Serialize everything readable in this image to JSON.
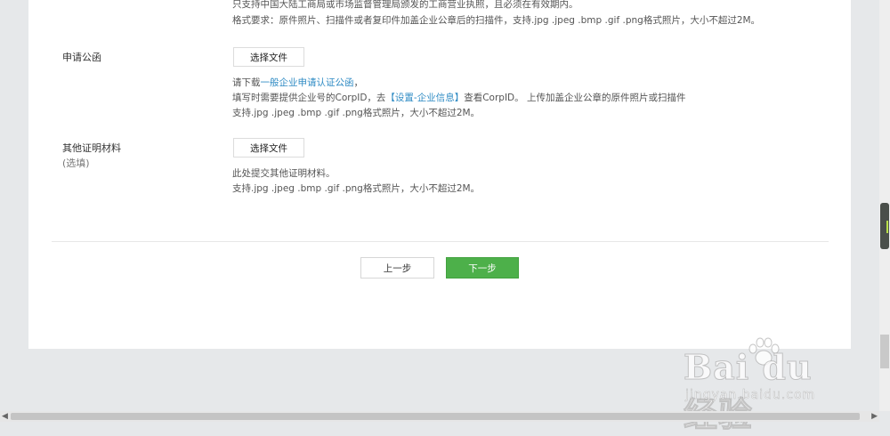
{
  "license_section": {
    "note_line1": "只支持中国大陆工商局或市场监督管理局颁发的工商营业执照，且必须在有效期内。",
    "note_line2": "格式要求：原件照片、扫描件或者复印件加盖企业公章后的扫描件，支持.jpg .jpeg .bmp .gif .png格式照片，大小不超过2M。"
  },
  "letter_section": {
    "label": "申请公函",
    "button": "选择文件",
    "line1_prefix": "请下载",
    "line1_link": "一般企业申请认证公函",
    "line1_suffix": "，",
    "line2_prefix": "填写时需要提供企业号的CorpID，去",
    "line2_link": "【设置-企业信息】",
    "line2_suffix": "查看CorpID。 上传加盖企业公章的原件照片或扫描件",
    "line3": "支持.jpg .jpeg .bmp .gif .png格式照片，大小不超过2M。"
  },
  "other_section": {
    "label": "其他证明材料",
    "sublabel": "(选填)",
    "button": "选择文件",
    "line1": "此处提交其他证明材料。",
    "line2": "支持.jpg .jpeg .bmp .gif .png格式照片，大小不超过2M。"
  },
  "nav": {
    "prev": "上一步",
    "next": "下一步"
  },
  "scrollbar": {
    "left_arrow": "◀",
    "right_arrow": "▶"
  },
  "watermark": {
    "logo": "Bai du 经验",
    "url": "jingyan.baidu.com"
  },
  "colors": {
    "primary_green": "#4db04a",
    "link_blue": "#2f8bc4",
    "page_bg": "#e6e8ea"
  }
}
